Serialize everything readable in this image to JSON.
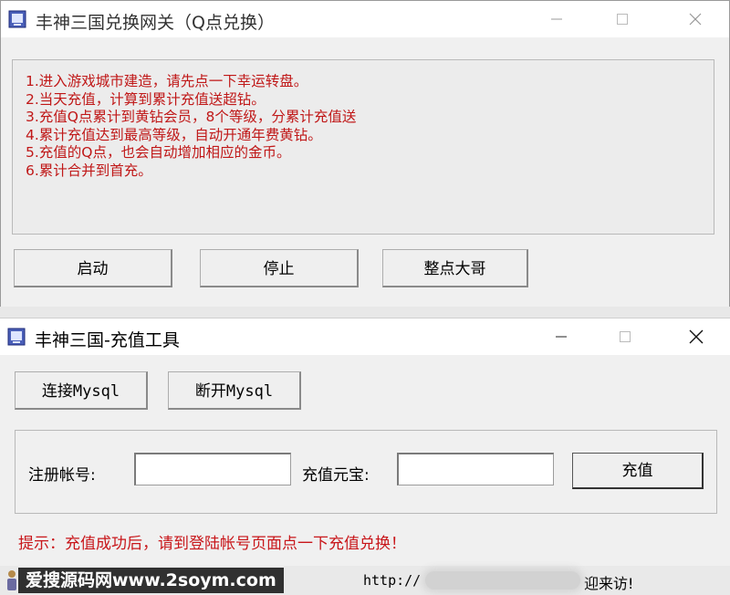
{
  "window_back": {
    "title": "丰神三国兑换网关（Q点兑换）",
    "info_lines": [
      "1.进入游戏城市建造，请先点一下幸运转盘。",
      "2.当天充值，计算到累计充值送超钻。",
      "3.充值Q点累计到黄钻会员，8个等级，分累计充值送",
      "4.累计充值达到最高等级，自动开通年费黄钻。",
      "5.充值的Q点，也会自动增加相应的金币。",
      "6.累计合并到首充。"
    ],
    "buttons": {
      "start": "启动",
      "stop": "停止",
      "hourly": "整点大哥"
    }
  },
  "window_front": {
    "title": "丰神三国-充值工具",
    "buttons": {
      "connect": "连接Mysql",
      "disconnect": "断开Mysql",
      "recharge": "充值"
    },
    "form": {
      "account_label": "注册帐号:",
      "account_value": "",
      "amount_label": "充值元宝:",
      "amount_value": ""
    },
    "hint": "提示：充值成功后，请到登陆帐号页面点一下充值兑换！"
  },
  "statusbar": {
    "url_prefix": "http://",
    "welcome": "迎来访!"
  },
  "watermark": "爱搜源码网www.2soym.com",
  "colors": {
    "info_text": "#c01818",
    "hint_text": "#c8161a"
  }
}
